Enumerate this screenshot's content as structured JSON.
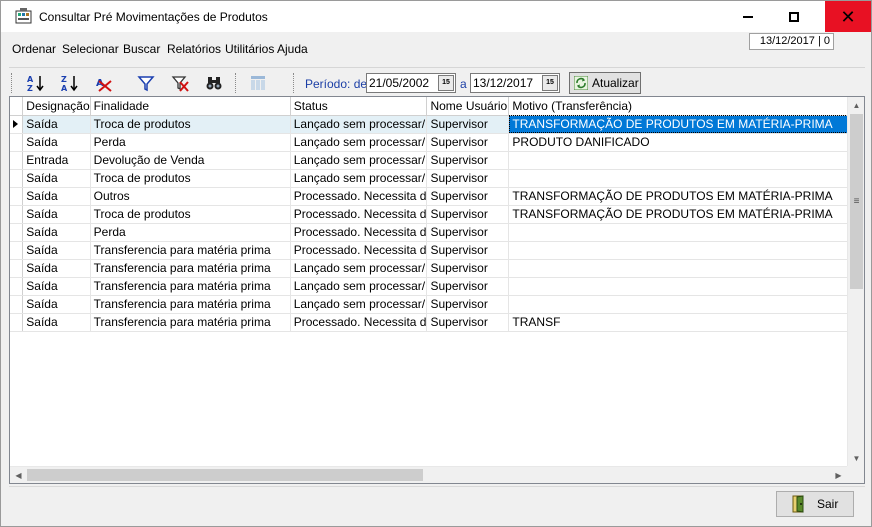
{
  "window": {
    "title": "Consultar Pré Movimentações de Produtos"
  },
  "menu": [
    "Ordenar",
    "Selecionar",
    "Buscar",
    "Relatórios",
    "Utilitários",
    "Ajuda"
  ],
  "status_date": "13/12/2017 | 0",
  "toolbar": {
    "period_label": "Período: de",
    "date_from": "21/05/2002",
    "a_label": "a",
    "date_to": "13/12/2017",
    "calendar_glyph": "15",
    "refresh_label": "Atualizar",
    "icons": [
      "sort-ascending-icon",
      "sort-descending-icon",
      "clear-sort-icon",
      "filter-icon",
      "clear-filter-icon",
      "binoculars-search-icon",
      "columns-icon"
    ]
  },
  "grid": {
    "columns": [
      "Designação",
      "Finalidade",
      "Status",
      "Nome Usuário",
      "Motivo (Transferência)"
    ],
    "rows": [
      [
        "Saída",
        "Troca de produtos",
        "Lançado sem processar/",
        "Supervisor",
        "TRANSFORMAÇÃO DE PRODUTOS EM MATÉRIA-PRIMA"
      ],
      [
        "Saída",
        "Perda",
        "Lançado sem processar/",
        "Supervisor",
        "PRODUTO DANIFICADO"
      ],
      [
        "Entrada",
        "Devolução de Venda",
        "Lançado sem processar/",
        "Supervisor",
        ""
      ],
      [
        "Saída",
        "Troca de produtos",
        "Lançado sem processar/",
        "Supervisor",
        ""
      ],
      [
        "Saída",
        "Outros",
        "Processado. Necessita d",
        "Supervisor",
        "TRANSFORMAÇÃO DE PRODUTOS EM MATÉRIA-PRIMA"
      ],
      [
        "Saída",
        "Troca de produtos",
        "Processado. Necessita d",
        "Supervisor",
        "TRANSFORMAÇÃO DE PRODUTOS EM MATÉRIA-PRIMA"
      ],
      [
        "Saída",
        "Perda",
        "Processado. Necessita d",
        "Supervisor",
        ""
      ],
      [
        "Saída",
        "Transferencia para matéria prima",
        "Processado. Necessita d",
        "Supervisor",
        ""
      ],
      [
        "Saída",
        "Transferencia para matéria prima",
        "Lançado sem processar/",
        "Supervisor",
        ""
      ],
      [
        "Saída",
        "Transferencia para matéria prima",
        "Lançado sem processar/",
        "Supervisor",
        ""
      ],
      [
        "Saída",
        "Transferencia para matéria prima",
        "Lançado sem processar/",
        "Supervisor",
        ""
      ],
      [
        "Saída",
        "Transferencia para matéria prima",
        "Processado. Necessita d",
        "Supervisor",
        "TRANSF"
      ]
    ],
    "current_row": 0,
    "selected_column": 4
  },
  "footer": {
    "exit_label": "Sair"
  },
  "colors": {
    "selection": "#0078d7",
    "current_row": "#e3f0f6",
    "close_hover": "#e81123",
    "period_text": "#1c3fa6"
  }
}
